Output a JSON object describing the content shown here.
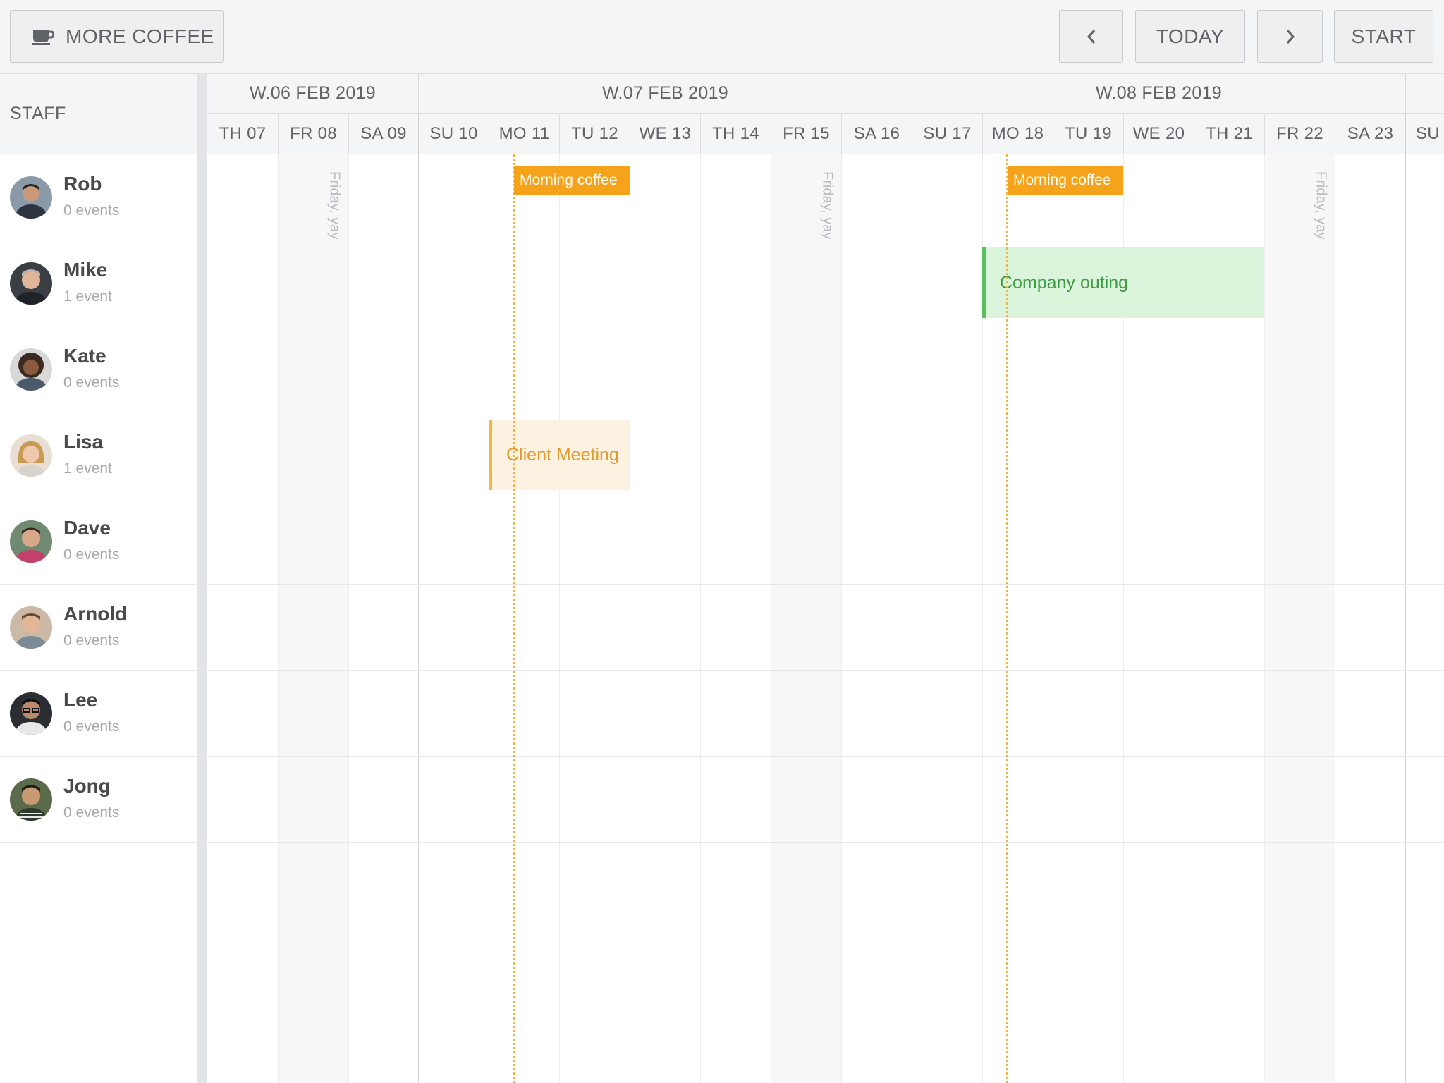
{
  "toolbar": {
    "more_coffee_label": "MORE COFFEE",
    "more_coffee_icon": "coffee-cup-icon",
    "today_label": "TODAY",
    "start_label": "START",
    "prev_icon": "chevron-left-icon",
    "next_icon": "chevron-right-icon"
  },
  "staff_header": "STAFF",
  "staff": [
    {
      "name": "Rob",
      "events": "0 events"
    },
    {
      "name": "Mike",
      "events": "1 event"
    },
    {
      "name": "Kate",
      "events": "0 events"
    },
    {
      "name": "Lisa",
      "events": "1 event"
    },
    {
      "name": "Dave",
      "events": "0 events"
    },
    {
      "name": "Arnold",
      "events": "0 events"
    },
    {
      "name": "Lee",
      "events": "0 events"
    },
    {
      "name": "Jong",
      "events": "0 events"
    }
  ],
  "weeks": [
    "W.06 FEB 2019",
    "W.07 FEB 2019",
    "W.08 FEB 2019"
  ],
  "days": [
    "TH 07",
    "FR 08",
    "SA 09",
    "SU 10",
    "MO 11",
    "TU 12",
    "WE 13",
    "TH 14",
    "FR 15",
    "SA 16",
    "SU 17",
    "MO 18",
    "TU 19",
    "WE 20",
    "TH 21",
    "FR 22",
    "SA 23",
    "SU"
  ],
  "friday_label": "Friday, yay",
  "events": {
    "morning_coffee_1": "Morning coffee",
    "morning_coffee_2": "Morning coffee",
    "company_outing": "Company outing",
    "client_meeting": "Client Meeting"
  },
  "colors": {
    "accent_orange": "#f6a31c",
    "outing_green": "#58c25c",
    "meeting_orange": "#f6b440"
  }
}
